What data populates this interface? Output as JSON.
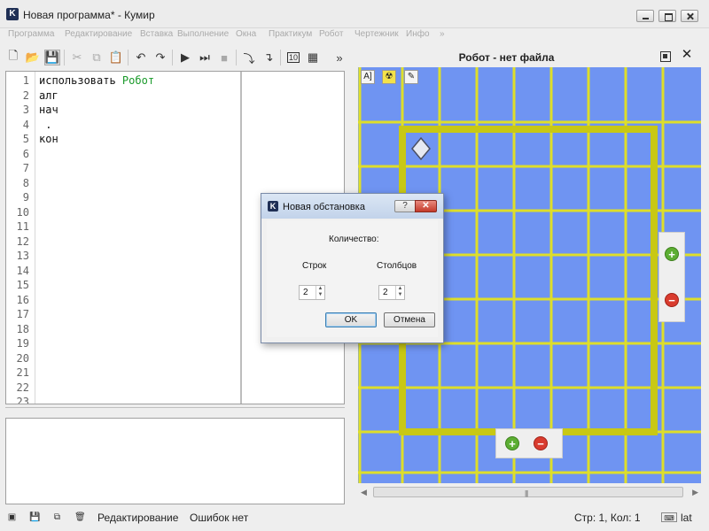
{
  "window": {
    "app_icon_letter": "K",
    "title": "Новая программа* - Кумир"
  },
  "menu": [
    "Программа",
    "Редактирование",
    "Вставка",
    "Выполнение",
    "Окна",
    "Практикум",
    "Робот",
    "Чертежник",
    "Инфо",
    "»"
  ],
  "toolbar": {
    "overflow": "»"
  },
  "editor": {
    "line_numbers": [
      "1",
      "2",
      "3",
      "4",
      "5",
      "6",
      "7",
      "8",
      "9",
      "10",
      "11",
      "12",
      "13",
      "14",
      "15",
      "16",
      "17",
      "18",
      "19",
      "20",
      "21",
      "22",
      "23"
    ],
    "lines": [
      {
        "keyword": "использовать ",
        "name": "Робот"
      },
      {
        "keyword": "алг",
        "name": ""
      },
      {
        "keyword": "нач",
        "name": ""
      },
      {
        "keyword": " .",
        "name": ""
      },
      {
        "keyword": "кон",
        "name": ""
      }
    ]
  },
  "statusbar": {
    "mode": "Редактирование",
    "errors": "Ошибок нет",
    "position": "Стр: 1, Кол: 1",
    "layout": "lat"
  },
  "robot": {
    "title": "Робот - нет файла",
    "close": "✕",
    "tools": [
      "A]",
      "☢",
      "✎"
    ]
  },
  "dialog": {
    "app_icon_letter": "K",
    "title": "Новая обстановка",
    "help": "?",
    "close": "✕",
    "quantity_label": "Количество:",
    "rows_label": "Строк",
    "cols_label": "Столбцов",
    "rows_value": "2",
    "cols_value": "2",
    "ok_label": "OK",
    "cancel_label": "Отмена"
  },
  "colors": {
    "field": "#6f94f2",
    "grid": "#dede2a",
    "wall": "#c8c814",
    "keyword_green": "#1a9a2a"
  }
}
